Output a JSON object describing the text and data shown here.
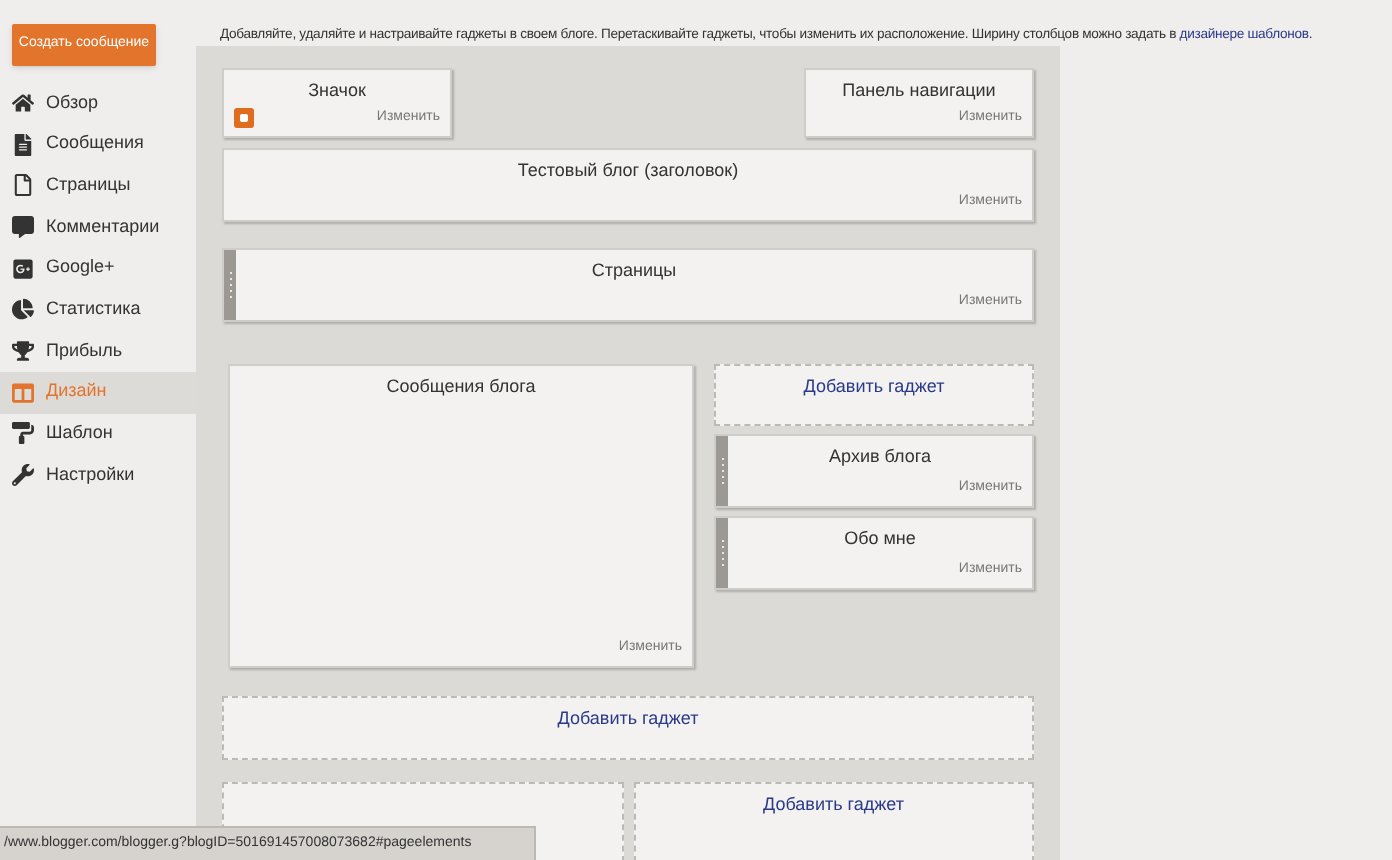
{
  "create_button": "Создать сообщение",
  "nav": [
    {
      "label": "Обзор",
      "selected": false
    },
    {
      "label": "Сообщения",
      "selected": false
    },
    {
      "label": "Страницы",
      "selected": false
    },
    {
      "label": "Комментарии",
      "selected": false
    },
    {
      "label": "Google+",
      "selected": false
    },
    {
      "label": "Статистика",
      "selected": false
    },
    {
      "label": "Прибыль",
      "selected": false
    },
    {
      "label": "Дизайн",
      "selected": true
    },
    {
      "label": "Шаблон",
      "selected": false
    },
    {
      "label": "Настройки",
      "selected": false
    }
  ],
  "intro": {
    "text": "Добавляйте, удаляйте и настраивайте гаджеты в своем блоге. Перетаскивайте гаджеты, чтобы изменить их расположение. Ширину столбцов можно задать в",
    "link": "дизайнере шаблонов",
    "end": "."
  },
  "top_gadgets": [
    {
      "title": "Значок",
      "edit": "Изменить",
      "draggable": false
    },
    {
      "title": "Панель навигации",
      "edit": "Изменить",
      "draggable": false
    }
  ],
  "header_gadget": {
    "title": "Тестовый блог (заголовок)",
    "edit": "Изменить",
    "draggable": false
  },
  "crosscol_gadget": {
    "title": "Страницы",
    "edit": "Изменить",
    "draggable": true
  },
  "main_gadget": {
    "title": "Сообщения блога",
    "edit": "Изменить",
    "draggable": false
  },
  "sidebar_gadgets": [
    {
      "kind": "add",
      "title": "Добавить гаджет"
    },
    {
      "kind": "gadget",
      "title": "Архив блога",
      "edit": "Изменить",
      "draggable": true
    },
    {
      "kind": "gadget",
      "title": "Обо мне",
      "edit": "Изменить",
      "draggable": true
    }
  ],
  "footer_add": "Добавить гаджет",
  "footer_columns": [
    {
      "kind": "add"
    },
    {
      "kind": "add",
      "title": "Добавить гаджет"
    }
  ],
  "status_url": "/www.blogger.com/blogger.g?blogID=501691457008073682#pageelements"
}
